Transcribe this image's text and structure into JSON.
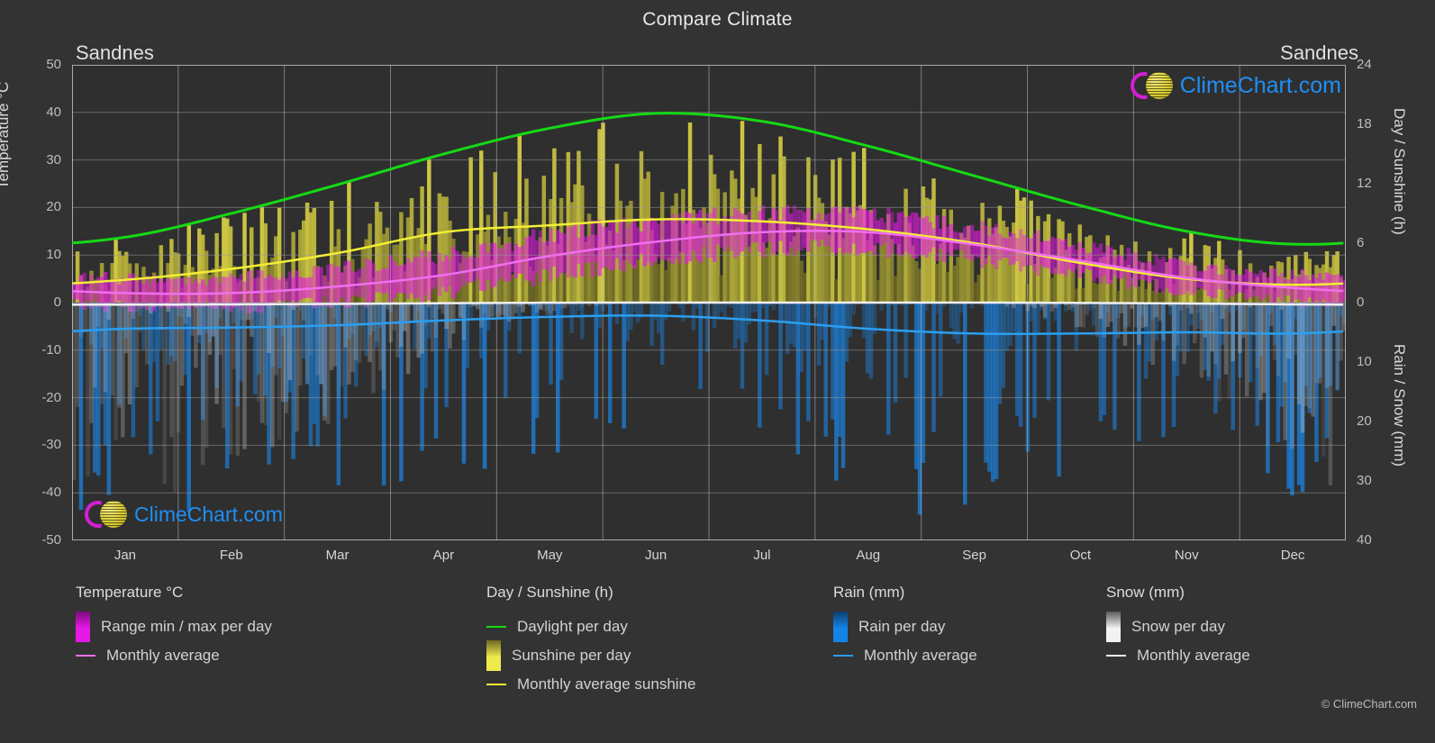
{
  "header": {
    "title": "Compare Climate",
    "city_left": "Sandnes",
    "city_right": "Sandnes"
  },
  "branding": {
    "logo_text": "ClimeChart.com",
    "copyright": "© ClimeChart.com"
  },
  "axes": {
    "left_label": "Temperature °C",
    "right_top_label": "Day / Sunshine (h)",
    "right_bottom_label": "Rain / Snow (mm)",
    "left_ticks": [
      "50",
      "40",
      "30",
      "20",
      "10",
      "0",
      "-10",
      "-20",
      "-30",
      "-40",
      "-50"
    ],
    "right_top_ticks": [
      "24",
      "18",
      "12",
      "6",
      "0"
    ],
    "right_bottom_ticks": [
      "0",
      "10",
      "20",
      "30",
      "40"
    ],
    "months": [
      "Jan",
      "Feb",
      "Mar",
      "Apr",
      "May",
      "Jun",
      "Jul",
      "Aug",
      "Sep",
      "Oct",
      "Nov",
      "Dec"
    ]
  },
  "legend": {
    "groups": [
      {
        "heading": "Temperature °C",
        "items": [
          {
            "label": "Range min / max per day",
            "swatch": "box",
            "color": "#e519e5",
            "color2": "#7d0b7d"
          },
          {
            "label": "Monthly average",
            "swatch": "line",
            "color": "#f06ef0"
          }
        ]
      },
      {
        "heading": "Day / Sunshine (h)",
        "items": [
          {
            "label": "Daylight per day",
            "swatch": "line",
            "color": "#15d915"
          },
          {
            "label": "Sunshine per day",
            "swatch": "box",
            "color": "#eeea4e",
            "color2": "#6e6a22"
          },
          {
            "label": "Monthly average sunshine",
            "swatch": "line",
            "color": "#f2ee35"
          }
        ]
      },
      {
        "heading": "Rain (mm)",
        "items": [
          {
            "label": "Rain per day",
            "swatch": "box",
            "color": "#1485e8",
            "color2": "#0d3f6e"
          },
          {
            "label": "Monthly average",
            "swatch": "line",
            "color": "#2a9ff0"
          }
        ]
      },
      {
        "heading": "Snow (mm)",
        "items": [
          {
            "label": "Snow per day",
            "swatch": "box",
            "color": "#f2f2f2",
            "color2": "#5a5a5a"
          },
          {
            "label": "Monthly average",
            "swatch": "line",
            "color": "#f0f0f0"
          }
        ]
      }
    ]
  },
  "chart_data": {
    "type": "line",
    "title": "Compare Climate",
    "subtitle": "Sandnes",
    "xlabel": "",
    "ylabel": "Temperature °C",
    "grid": true,
    "legend_position": "bottom",
    "x": [
      "Jan",
      "Feb",
      "Mar",
      "Apr",
      "May",
      "Jun",
      "Jul",
      "Aug",
      "Sep",
      "Oct",
      "Nov",
      "Dec"
    ],
    "axis_ranges": {
      "temperature_c": [
        -50,
        50
      ],
      "day_sunshine_h": [
        0,
        24
      ],
      "rain_snow_mm": [
        0,
        40
      ]
    },
    "series": [
      {
        "name": "Daylight per day",
        "unit": "h",
        "axis": "day_sunshine_h",
        "color": "#15d915",
        "values": [
          6.6,
          9.0,
          11.9,
          15.0,
          17.6,
          19.1,
          18.3,
          15.8,
          12.8,
          9.8,
          7.2,
          5.9
        ]
      },
      {
        "name": "Monthly average sunshine",
        "unit": "h",
        "axis": "day_sunshine_h",
        "color": "#f2ee35",
        "values": [
          2.3,
          3.4,
          5.0,
          7.1,
          7.8,
          8.4,
          8.2,
          7.4,
          6.0,
          4.0,
          2.4,
          1.8
        ]
      },
      {
        "name": "Monthly average temperature",
        "unit": "°C",
        "axis": "temperature_c",
        "color": "#f06ef0",
        "values": [
          2.0,
          2.0,
          3.4,
          5.8,
          9.8,
          12.8,
          14.8,
          14.8,
          12.2,
          8.8,
          5.2,
          3.1
        ]
      },
      {
        "name": "Monthly average rain",
        "unit": "mm",
        "axis": "rain_snow_mm",
        "color": "#2a9ff0",
        "values": [
          4.4,
          4.2,
          3.8,
          3.0,
          2.4,
          2.2,
          3.0,
          4.4,
          5.2,
          5.2,
          5.0,
          5.2
        ]
      },
      {
        "name": "Monthly average snow",
        "unit": "mm",
        "axis": "rain_snow_mm",
        "color": "#f0f0f0",
        "values": [
          0.35,
          0.3,
          0.22,
          0.1,
          0.02,
          0.0,
          0.0,
          0.0,
          0.0,
          0.05,
          0.15,
          0.3
        ]
      }
    ],
    "bands": [
      {
        "name": "Range min / max per day",
        "unit": "°C",
        "axis": "temperature_c",
        "color": "#e519e5",
        "min": [
          -1.0,
          -1.2,
          0.2,
          2.0,
          5.6,
          8.8,
          11.0,
          11.2,
          8.8,
          5.6,
          2.2,
          0.2
        ],
        "max": [
          5.2,
          5.4,
          7.2,
          10.2,
          14.6,
          17.2,
          19.0,
          18.8,
          16.0,
          12.2,
          8.0,
          6.0
        ]
      },
      {
        "name": "Sunshine per day",
        "unit": "h",
        "axis": "day_sunshine_h",
        "color": "#eeea4e",
        "min": [
          0,
          0,
          0,
          0,
          0,
          0,
          0,
          0,
          0,
          0,
          0,
          0
        ],
        "max": [
          6.6,
          9.0,
          11.9,
          15.0,
          17.6,
          19.1,
          18.3,
          15.8,
          12.8,
          9.8,
          7.2,
          5.9
        ]
      },
      {
        "name": "Rain per day",
        "unit": "mm",
        "axis": "rain_snow_mm",
        "color": "#1485e8",
        "min": [
          0,
          0,
          0,
          0,
          0,
          0,
          0,
          0,
          0,
          0,
          0,
          0
        ],
        "max": [
          40,
          35,
          38,
          30,
          26,
          24,
          30,
          34,
          38,
          36,
          36,
          34
        ]
      }
    ]
  }
}
